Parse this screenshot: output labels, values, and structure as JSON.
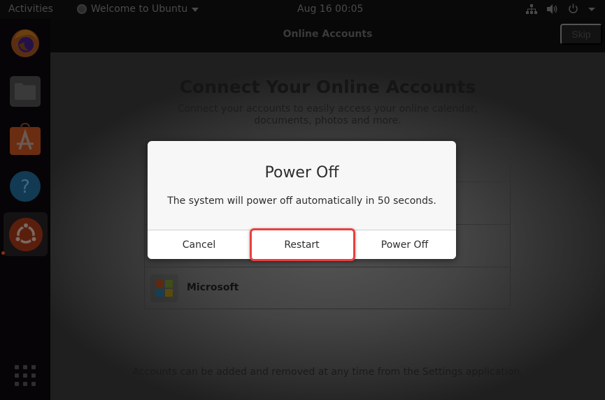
{
  "topbar": {
    "activities_label": "Activities",
    "app_menu_label": "Welcome to Ubuntu",
    "clock": "Aug 16  00:05",
    "tray_icons": [
      "network-icon",
      "volume-icon",
      "power-icon",
      "system-menu-caret-icon"
    ]
  },
  "dock": {
    "items": [
      {
        "name": "Firefox",
        "icon": "firefox-icon"
      },
      {
        "name": "Files",
        "icon": "files-icon"
      },
      {
        "name": "Ubuntu Software",
        "icon": "software-icon"
      },
      {
        "name": "Help",
        "icon": "help-icon"
      },
      {
        "name": "Welcome to Ubuntu",
        "icon": "ubuntu-icon",
        "active": true
      }
    ],
    "show_apps_icon": "apps-grid-icon"
  },
  "window": {
    "title": "Online Accounts",
    "skip_label": "Skip",
    "heading": "Connect Your Online Accounts",
    "subheading": "Connect your accounts to easily access your online calendar, documents, photos and more.",
    "accounts": [
      {
        "label": ""
      },
      {
        "label": ""
      },
      {
        "label": ""
      },
      {
        "label": "Microsoft",
        "icon": "microsoft-icon"
      }
    ],
    "footnote": "Accounts can be added and removed at any time from the Settings application."
  },
  "dialog": {
    "title": "Power Off",
    "message": "The system will power off automatically in 50 seconds.",
    "countdown_seconds": 50,
    "buttons": {
      "cancel": "Cancel",
      "restart": "Restart",
      "power_off": "Power Off"
    },
    "highlighted_button": "restart",
    "highlight_color": "#e8403f"
  },
  "colors": {
    "microsoft_red": "#5a2a14",
    "microsoft_green": "#3e4d1a",
    "microsoft_blue": "#163f54",
    "microsoft_yellow": "#5a4a0c"
  }
}
